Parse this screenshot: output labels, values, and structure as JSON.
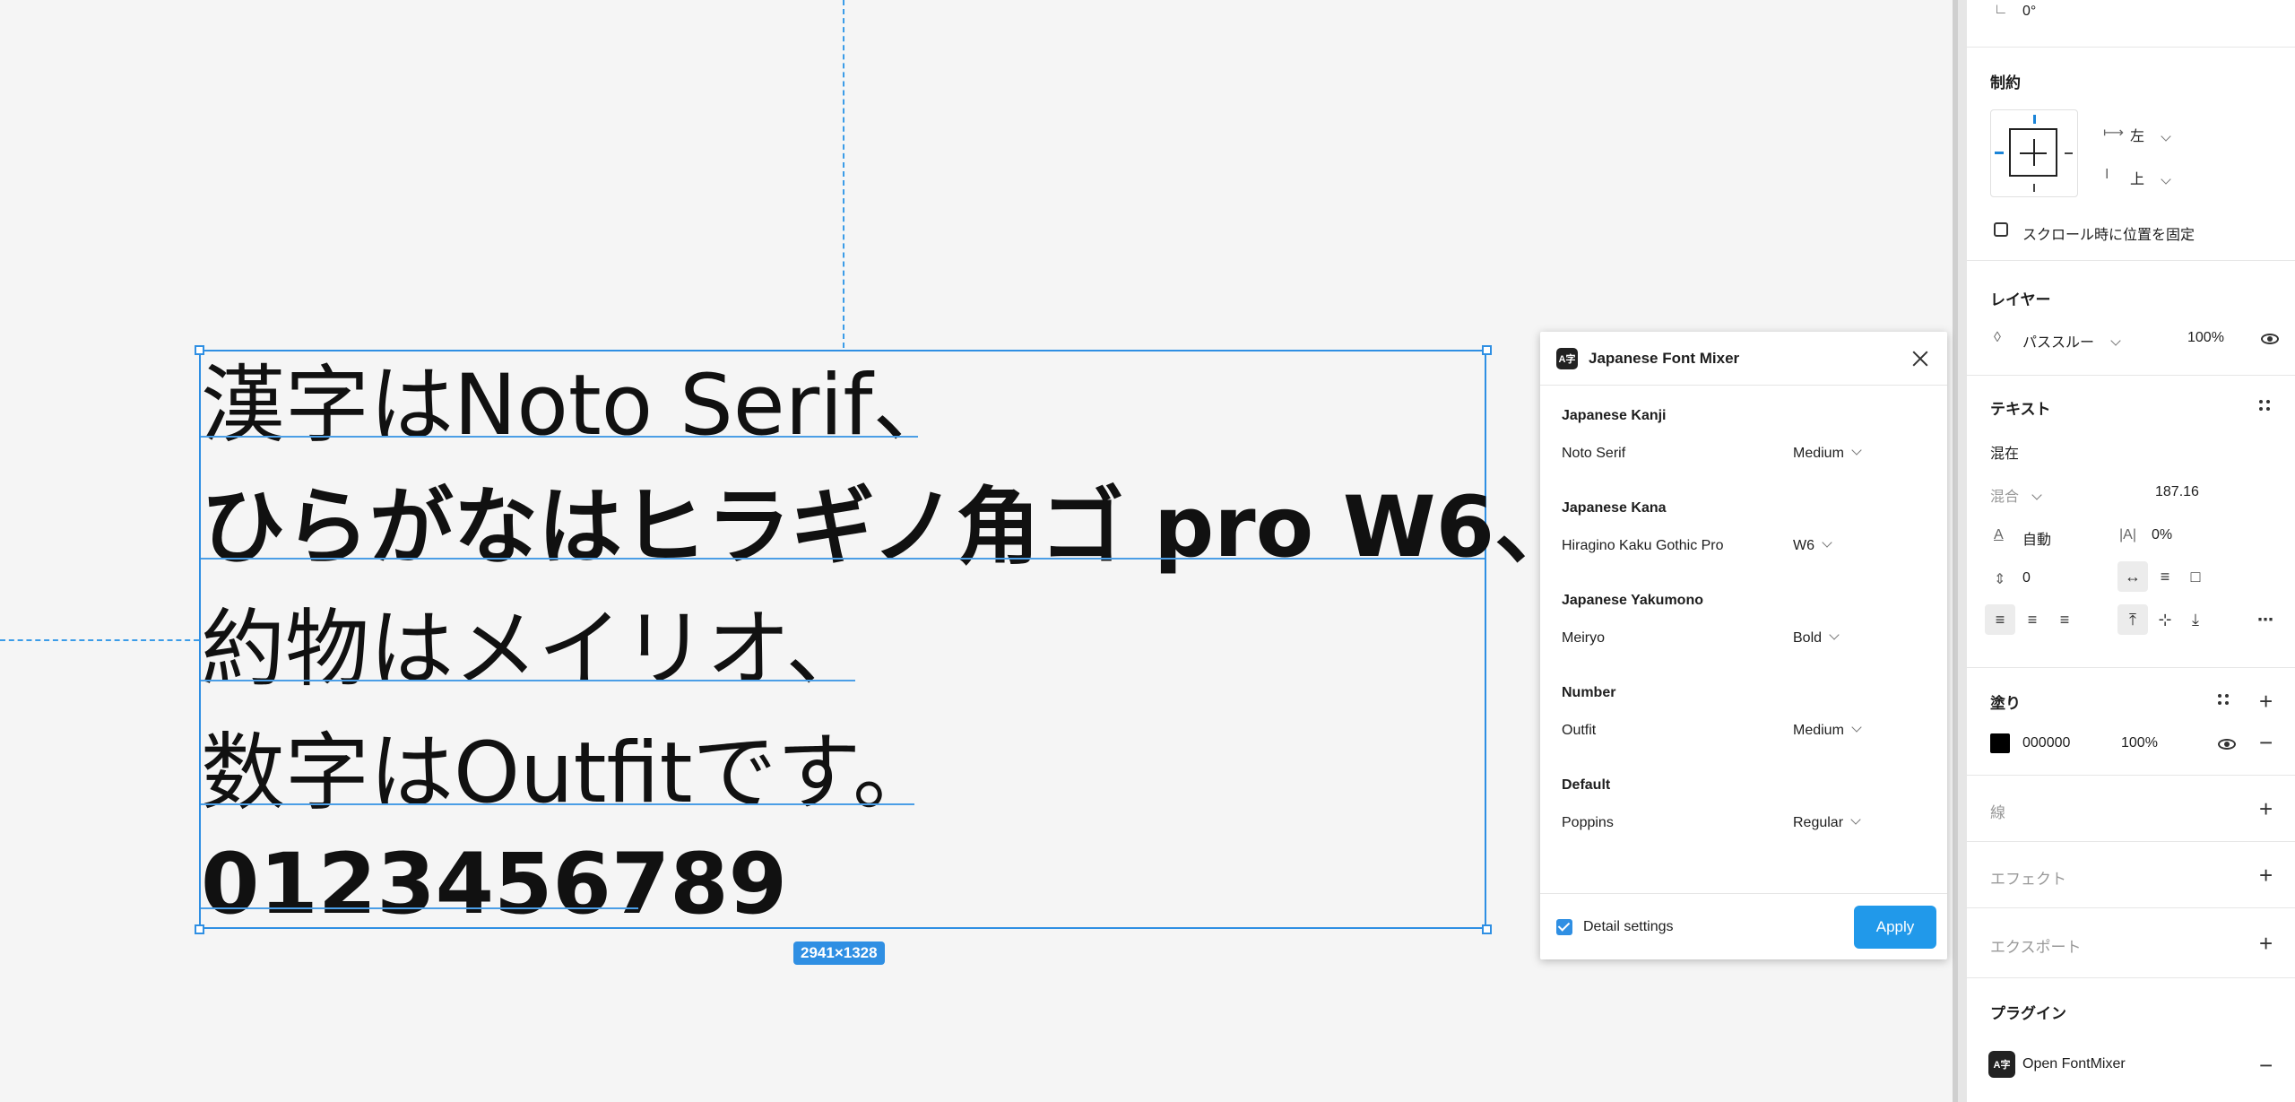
{
  "canvas": {
    "size_badge": "2941×1328",
    "text_lines": [
      "漢字はNoto Serif、",
      "ひらがなはヒラギノ角ゴ pro W6、",
      "約物はメイリオ、",
      "数字はOutfitです。",
      "0123456789"
    ]
  },
  "plugin": {
    "logo": "A字",
    "title": "Japanese Font Mixer",
    "sections": [
      {
        "title": "Japanese Kanji",
        "font": "Noto Serif",
        "weight": "Medium"
      },
      {
        "title": "Japanese Kana",
        "font": "Hiragino Kaku Gothic Pro",
        "weight": "W6"
      },
      {
        "title": "Japanese Yakumono",
        "font": "Meiryo",
        "weight": "Bold"
      },
      {
        "title": "Number",
        "font": "Outfit",
        "weight": "Medium"
      },
      {
        "title": "Default",
        "font": "Poppins",
        "weight": "Regular"
      }
    ],
    "detail_settings_label": "Detail settings",
    "apply_label": "Apply"
  },
  "panel": {
    "rotation": "0°",
    "constraints": {
      "title": "制約",
      "horizontal": "左",
      "vertical": "上",
      "fix_scroll": "スクロール時に位置を固定"
    },
    "layer": {
      "title": "レイヤー",
      "blend": "パススルー",
      "opacity": "100%"
    },
    "text": {
      "title": "テキスト",
      "mixed": "混在",
      "style_mixed": "混合",
      "size": "187.16",
      "line_height": "自動",
      "letter_spacing": "0%",
      "paragraph_spacing": "0"
    },
    "fill": {
      "title": "塗り",
      "hex": "000000",
      "opacity": "100%"
    },
    "stroke_title": "線",
    "effects_title": "エフェクト",
    "export_title": "エクスポート",
    "plugins": {
      "title": "プラグイン",
      "item_logo": "A字",
      "item": "Open FontMixer"
    }
  }
}
